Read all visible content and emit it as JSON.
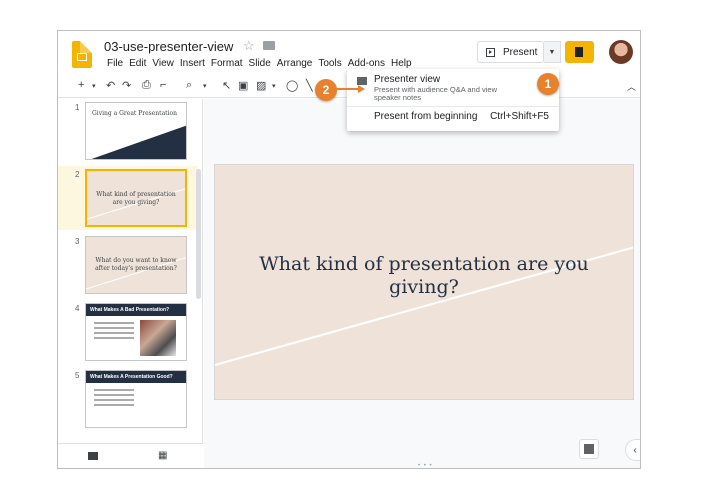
{
  "header": {
    "doc_title": "03-use-presenter-view",
    "menu": [
      "File",
      "Edit",
      "View",
      "Insert",
      "Format",
      "Slide",
      "Arrange",
      "Tools",
      "Add-ons",
      "Help"
    ],
    "present_label": "Present"
  },
  "dropdown": {
    "item1_title": "Presenter view",
    "item1_desc": "Present with audience Q&A and view speaker notes",
    "item2_title": "Present from beginning",
    "item2_shortcut": "Ctrl+Shift+F5"
  },
  "slides": [
    {
      "num": "1",
      "title": "Giving a Great Presentation"
    },
    {
      "num": "2",
      "text": "What kind of presentation are you giving?"
    },
    {
      "num": "3",
      "text": "What do you want to know after today's presentation?"
    },
    {
      "num": "4",
      "title": "What Makes A Bad Presentation?"
    },
    {
      "num": "5",
      "title": "What Makes A Presentation Good?"
    }
  ],
  "main_slide": {
    "text": "What kind of presentation are you giving?"
  },
  "callouts": [
    "1",
    "2"
  ],
  "colors": {
    "accent": "#f4b400",
    "callout": "#e8812e",
    "slide_bg": "#efe3d9",
    "navy": "#233044"
  }
}
